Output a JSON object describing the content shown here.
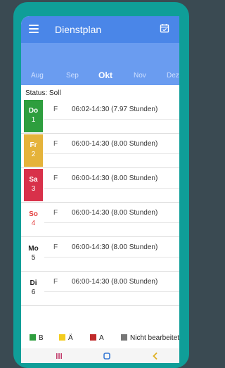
{
  "appbar": {
    "title": "Dienstplan",
    "menu_icon": "menu-icon",
    "calendar_icon": "calendar-icon"
  },
  "months": [
    "Aug",
    "Sep",
    "Okt",
    "Nov",
    "Dez"
  ],
  "active_month": "Okt",
  "status": "Status: Soll",
  "days": [
    {
      "name": "Do",
      "num": "1",
      "code": "F",
      "shift": "06:02-14:30 (7.97 Stunden)",
      "box_color": "#2e9e3e",
      "text_color": "#ffffff"
    },
    {
      "name": "Fr",
      "num": "2",
      "code": "F",
      "shift": "06:00-14:30 (8.00 Stunden)",
      "box_color": "#e5b33a",
      "text_color": "#ffffff"
    },
    {
      "name": "Sa",
      "num": "3",
      "code": "F",
      "shift": "06:00-14:30 (8.00 Stunden)",
      "box_color": "#d8314a",
      "text_color": "#ffffff"
    },
    {
      "name": "So",
      "num": "4",
      "code": "F",
      "shift": "06:00-14:30 (8.00 Stunden)",
      "box_color": "#ffffff",
      "text_color": "#e23b3b"
    },
    {
      "name": "Mo",
      "num": "5",
      "code": "F",
      "shift": "06:00-14:30 (8.00 Stunden)",
      "box_color": "#ffffff",
      "text_color": "#222222"
    },
    {
      "name": "Di",
      "num": "6",
      "code": "F",
      "shift": "06:00-14:30 (8.00 Stunden)",
      "box_color": "#ffffff",
      "text_color": "#222222"
    }
  ],
  "legend": [
    {
      "label": "B",
      "color": "#2e9e3e"
    },
    {
      "label": "Ä",
      "color": "#f3cc1e"
    },
    {
      "label": "A",
      "color": "#c02a2a"
    },
    {
      "label": "Nicht bearbeitet",
      "color": "#777777"
    }
  ],
  "navbar": {
    "recents_icon": "recents-icon",
    "home_icon": "home-icon",
    "back_icon": "back-icon"
  }
}
